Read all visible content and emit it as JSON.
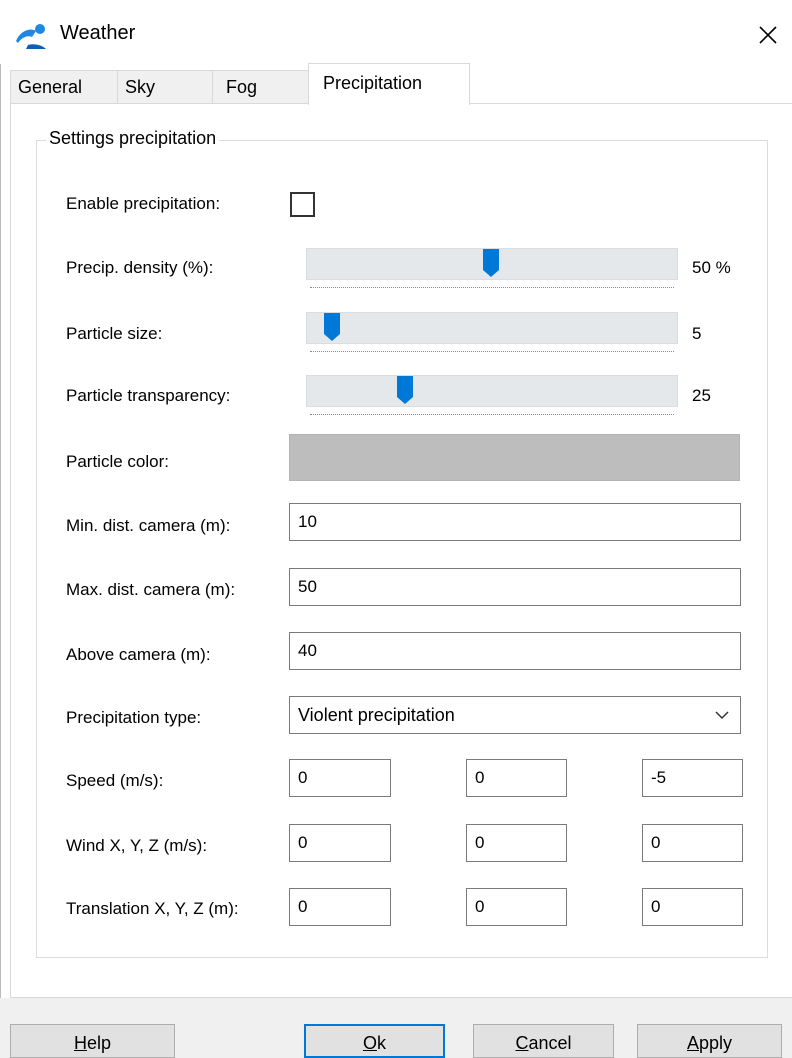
{
  "window": {
    "title": "Weather",
    "icon": "weather-app-icon",
    "close_glyph": "✕"
  },
  "tabs": [
    {
      "label": "General"
    },
    {
      "label": "Sky"
    },
    {
      "label": "Fog"
    },
    {
      "label": "Precipitation",
      "active": true
    }
  ],
  "group": {
    "title": "Settings precipitation"
  },
  "fields": {
    "enable_precipitation": {
      "label": "Enable precipitation:",
      "checked": false
    },
    "precip_density": {
      "label": "Precip. density (%):",
      "value": 50,
      "display": "50 %"
    },
    "particle_size": {
      "label": "Particle size:",
      "value": 5,
      "display": "5"
    },
    "particle_transparency": {
      "label": "Particle transparency:",
      "value": 25,
      "display": "25"
    },
    "particle_color": {
      "label": "Particle color:",
      "color": "#bdbdbd"
    },
    "min_dist_camera": {
      "label": "Min. dist. camera (m):",
      "value": "10"
    },
    "max_dist_camera": {
      "label": "Max. dist. camera (m):",
      "value": "50"
    },
    "above_camera": {
      "label": "Above camera (m):",
      "value": "40"
    },
    "precipitation_type": {
      "label": "Precipitation type:",
      "value": "Violent precipitation"
    },
    "speed": {
      "label": "Speed (m/s):",
      "x": "0",
      "y": "0",
      "z": "-5"
    },
    "wind": {
      "label": "Wind X, Y, Z (m/s):",
      "x": "0",
      "y": "0",
      "z": "0"
    },
    "translation": {
      "label": "Translation X, Y, Z (m):",
      "x": "0",
      "y": "0",
      "z": "0"
    }
  },
  "buttons": {
    "help": {
      "mnemonic": "H",
      "rest": "elp"
    },
    "ok": {
      "mnemonic": "O",
      "rest": "k"
    },
    "cancel": {
      "mnemonic": "C",
      "rest": "ancel"
    },
    "apply": {
      "mnemonic": "A",
      "rest": "pply"
    }
  },
  "colors": {
    "accent": "#0078d7",
    "slider_track": "#e5e8eb",
    "swatch": "#bdbdbd"
  }
}
